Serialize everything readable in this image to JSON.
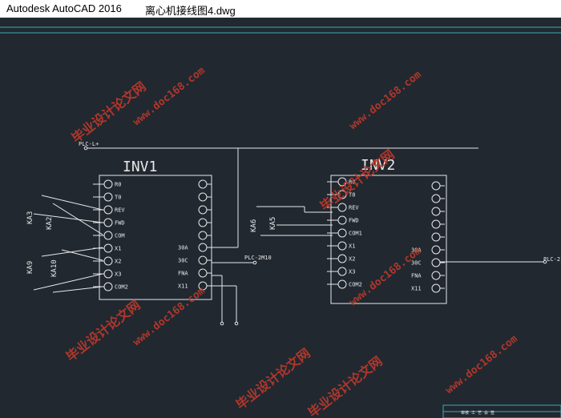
{
  "window": {
    "app_title": "Autodesk AutoCAD 2016",
    "file_title": "离心机接线图4.dwg"
  },
  "colors": {
    "background": "#212830",
    "line": "#e8e8e8",
    "accent_cyan": "#3ea8b8",
    "watermark": "#c0392b"
  },
  "drawing": {
    "net_top": "PLC-L+",
    "net_mid": "PLC-2M10",
    "net_right": "PLC-2",
    "inv1": {
      "title": "INV1",
      "left_terminals": [
        "R0",
        "T0",
        "REV",
        "FWD",
        "COM",
        "X1",
        "X2",
        "X3",
        "COM2"
      ],
      "right_terminals": [
        "30A",
        "30C",
        "FNA",
        "X11"
      ]
    },
    "inv2": {
      "title": "INV2",
      "left_terminals": [
        "R0",
        "T0",
        "REV",
        "FWD",
        "COM1",
        "X1",
        "X2",
        "X3",
        "COM2"
      ],
      "right_terminals": [
        "30A",
        "30C",
        "FNA",
        "X11"
      ]
    },
    "relays": [
      "KA3",
      "KA2",
      "KA9",
      "KA10",
      "KA6",
      "KA5"
    ],
    "titleblock_text": "审核  工  艺  会  签"
  },
  "watermarks": [
    "www.doc168.com",
    "毕业设计论文网",
    "www.doc168.com",
    "毕业设计论文网",
    "www.doc168.com",
    "毕业设计论文网",
    "www.doc168.com",
    "毕业设计论文网",
    "www.doc168.com",
    "毕业设计论文网"
  ]
}
